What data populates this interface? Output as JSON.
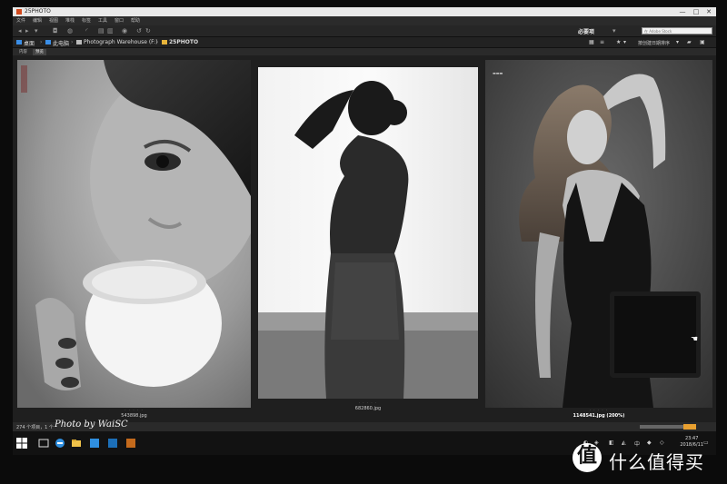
{
  "window": {
    "title": "25PHOTO",
    "minimize": "—",
    "maximize": "□",
    "close": "✕"
  },
  "menu": [
    "文件",
    "编辑",
    "视图",
    "堆栈",
    "标签",
    "工具",
    "窗口",
    "帮助"
  ],
  "toolbar": {
    "workspace": "必要项",
    "search_placeholder": "在 Adobe Stock"
  },
  "path": {
    "items": [
      "桌面",
      "此电脑",
      "Photograph Warehouse (F:)",
      "25PHOTO"
    ]
  },
  "view_controls": {
    "sort_label": "按创建日期排序"
  },
  "tabs": [
    "内容",
    "预览"
  ],
  "thumbnails": [
    {
      "filename": "543898.jpg"
    },
    {
      "filename": "682860.jpg"
    },
    {
      "filename": "1148541.jpg (200%)"
    }
  ],
  "status": {
    "text": "274 个项目，1 个",
    "zoom_label": ""
  },
  "taskbar": {
    "time": "23:47",
    "date": "2018/6/11"
  },
  "overlays": {
    "watermark": "Photo by WaiSC",
    "brand_logo_char": "值",
    "brand_text": "什么值得买"
  },
  "colors": {
    "app_accent": "#d24a1e",
    "folder": "#e8b43a",
    "nav_blue": "#3a8ee6"
  },
  "icons": {
    "back": "◂",
    "forward": "▸",
    "rotate_left": "↺",
    "rotate_right": "↻",
    "chevron": "▾",
    "star": "★",
    "sep": "›"
  }
}
